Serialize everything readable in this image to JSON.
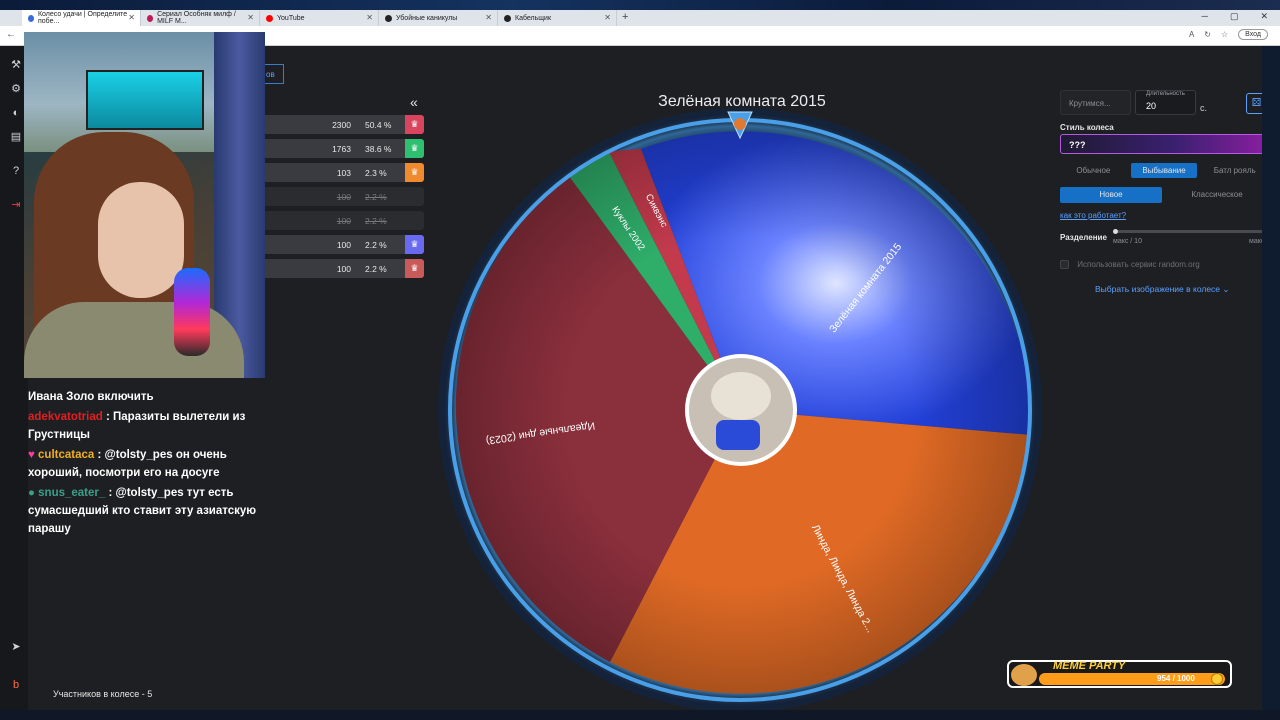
{
  "browser": {
    "tabs": [
      {
        "title": "Колесо удачи | Определите побе...",
        "color": "#3a6bd8",
        "active": true
      },
      {
        "title": "Сериал Особняк милф / MILF M...",
        "color": "#c2185b",
        "active": false
      },
      {
        "title": "YouTube",
        "color": "#ff0000",
        "active": false
      },
      {
        "title": "Убойные каникулы",
        "color": "#222222",
        "active": false
      },
      {
        "title": "Кабельщик",
        "color": "#222222",
        "active": false
      }
    ],
    "login_label": "Вход"
  },
  "participants": {
    "rows": [
      {
        "count": "2300",
        "pct": "50.4 %",
        "color": "#d9455f",
        "dim": false
      },
      {
        "count": "1763",
        "pct": "38.6 %",
        "color": "#2fbf71",
        "dim": false
      },
      {
        "count": "103",
        "pct": "2.3 %",
        "color": "#ef8a2e",
        "dim": false
      },
      {
        "count": "100",
        "pct": "2.2 %",
        "color": "#2b2c30",
        "dim": true
      },
      {
        "count": "100",
        "pct": "2.2 %",
        "color": "#2b2c30",
        "dim": true
      },
      {
        "count": "100",
        "pct": "2.2 %",
        "color": "#6a6af0",
        "dim": false
      },
      {
        "count": "100",
        "pct": "2.2 %",
        "color": "#c95a5a",
        "dim": false
      }
    ],
    "collapse_symbol": "«",
    "count_label": "Участников в колесе - 5"
  },
  "chat": [
    {
      "user": "",
      "user_color": "#ffffff",
      "text": "Ивана Золо включить"
    },
    {
      "user": "adekvatotriad",
      "user_color": "#e02020",
      "text": ": Паразиты вылетели из Грустницы"
    },
    {
      "user": "cultcataca",
      "user_color": "#f0b020",
      "text": ": @tolsty_pes он очень хороший, посмотри его на досуге"
    },
    {
      "user": "snus_eater_",
      "user_color": "#3aa08a",
      "text": ": @tolsty_pes тут есть сумасшедший кто ставит эту азиатскую парашу"
    }
  ],
  "wheel": {
    "title": "Зелёная комната 2015",
    "segments": [
      {
        "label": "Зелёная комната 2015",
        "color": "#2f55e8"
      },
      {
        "label": "Линда, Линда, Линда 2...",
        "color": "#e06a25"
      },
      {
        "label": "Идеальные дни (2023)",
        "color": "#8a2f3c"
      },
      {
        "label": "Куклы 2002",
        "color": "#2fae6a"
      },
      {
        "label": "Сиквэнс",
        "color": "#c23a4c"
      }
    ]
  },
  "settings": {
    "spin_label": "Крутимся...",
    "duration_label": "Длительность",
    "duration_value": "20",
    "seconds_unit": "с.",
    "style_label": "Стиль колеса",
    "style_value": "???",
    "mode_tabs": [
      "Обычное",
      "Выбывание",
      "Батл рояль"
    ],
    "variant_tabs": [
      "Новое",
      "Классическое"
    ],
    "how_link": "как это работает?",
    "split_label": "Разделение",
    "split_min": "макс / 10",
    "split_max": "макс",
    "random_org": "Использовать сервис random.org",
    "image_select": "Выбрать изображение в колесе"
  },
  "meme_party": {
    "title": "MEME PARTY",
    "progress": "954 / 1000"
  },
  "app_tab_label": "ов"
}
